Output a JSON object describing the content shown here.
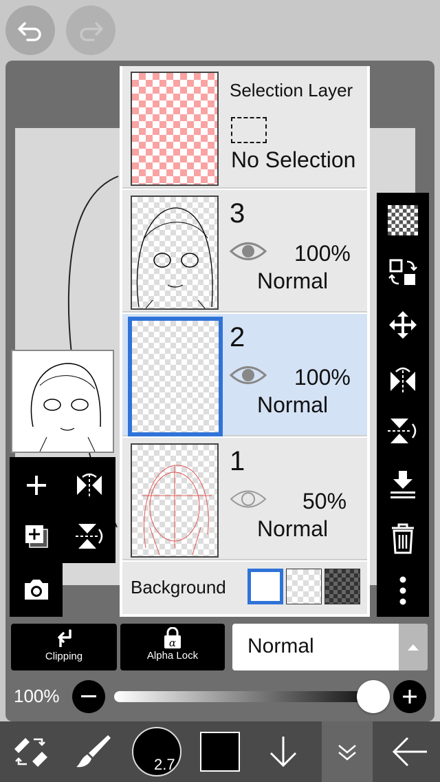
{
  "layers_panel": {
    "selection_layer": {
      "title": "Selection Layer",
      "status": "No Selection"
    },
    "layers": [
      {
        "number": "3",
        "opacity": "100%",
        "blend": "Normal",
        "visible": true,
        "selected": false
      },
      {
        "number": "2",
        "opacity": "100%",
        "blend": "Normal",
        "visible": true,
        "selected": true
      },
      {
        "number": "1",
        "opacity": "50%",
        "blend": "Normal",
        "visible": true,
        "selected": false
      }
    ],
    "background_label": "Background"
  },
  "toolbar": {
    "clipping_label": "Clipping",
    "alpha_lock_label": "Alpha Lock",
    "blend_mode": "Normal"
  },
  "opacity_slider": {
    "label": "100%",
    "value": 1.0
  },
  "bottom_bar": {
    "brush_size": "2.7"
  },
  "colors": {
    "selected_highlight": "#2f73d8",
    "selected_row": "#d4e2f5",
    "primary_color": "#000000"
  },
  "icons": [
    "undo-icon",
    "redo-icon",
    "checker-icon",
    "transform-layer-icon",
    "move-icon",
    "flip-horizontal-icon",
    "flip-vertical-icon",
    "merge-down-icon",
    "trash-icon",
    "more-icon",
    "add-layer-icon",
    "add-copy-layer-icon",
    "camera-icon",
    "clipping-icon",
    "alpha-lock-icon",
    "chevron-up-icon",
    "minus-icon",
    "plus-icon",
    "swap-tools-icon",
    "brush-icon",
    "arrow-down-icon",
    "double-chevron-down-icon",
    "back-arrow-icon"
  ]
}
